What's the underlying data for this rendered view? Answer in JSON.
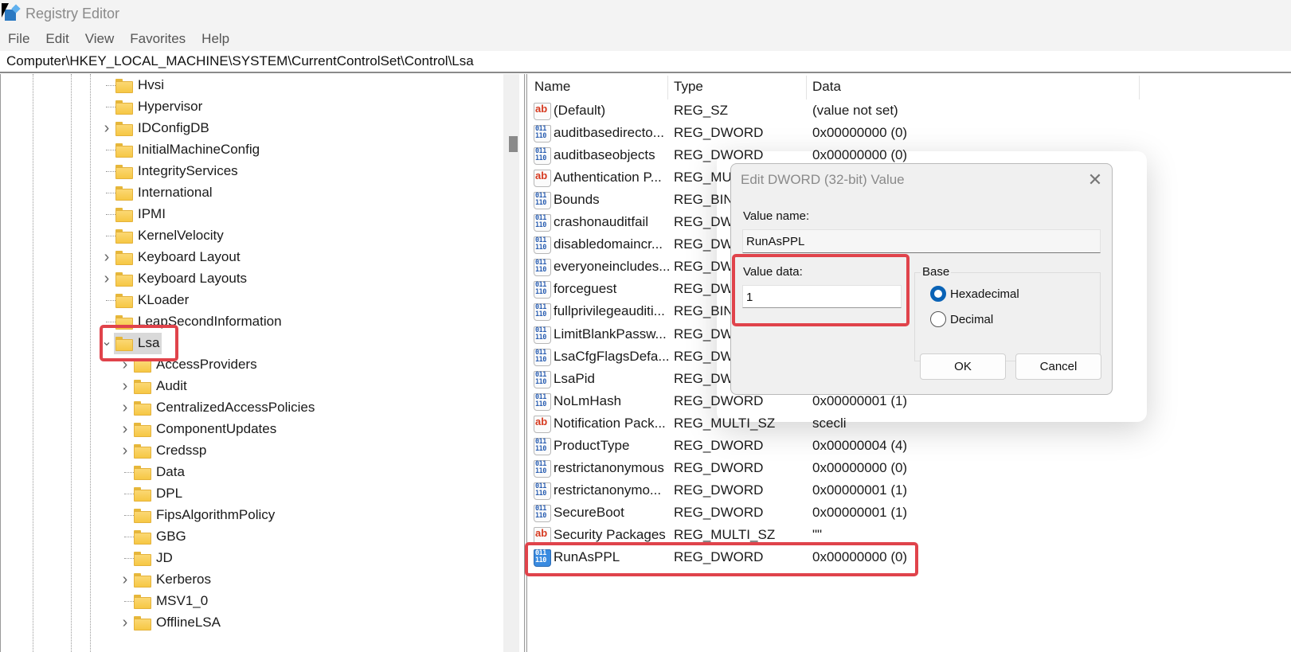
{
  "window": {
    "title": "Registry Editor",
    "app_icon": "registry-editor-icon"
  },
  "menu": [
    "File",
    "Edit",
    "View",
    "Favorites",
    "Help"
  ],
  "address": "Computer\\HKEY_LOCAL_MACHINE\\SYSTEM\\CurrentControlSet\\Control\\Lsa",
  "tree": {
    "items": [
      {
        "label": "Hvsi",
        "level": 0,
        "expander": "none"
      },
      {
        "label": "Hypervisor",
        "level": 0,
        "expander": "none"
      },
      {
        "label": "IDConfigDB",
        "level": 0,
        "expander": "collapsed"
      },
      {
        "label": "InitialMachineConfig",
        "level": 0,
        "expander": "none"
      },
      {
        "label": "IntegrityServices",
        "level": 0,
        "expander": "none"
      },
      {
        "label": "International",
        "level": 0,
        "expander": "none"
      },
      {
        "label": "IPMI",
        "level": 0,
        "expander": "none"
      },
      {
        "label": "KernelVelocity",
        "level": 0,
        "expander": "none"
      },
      {
        "label": "Keyboard Layout",
        "level": 0,
        "expander": "collapsed"
      },
      {
        "label": "Keyboard Layouts",
        "level": 0,
        "expander": "collapsed"
      },
      {
        "label": "KLoader",
        "level": 0,
        "expander": "none"
      },
      {
        "label": "LeapSecondInformation",
        "level": 0,
        "expander": "none"
      },
      {
        "label": "Lsa",
        "level": 0,
        "expander": "expanded",
        "selected": true
      },
      {
        "label": "AccessProviders",
        "level": 1,
        "expander": "collapsed"
      },
      {
        "label": "Audit",
        "level": 1,
        "expander": "collapsed"
      },
      {
        "label": "CentralizedAccessPolicies",
        "level": 1,
        "expander": "collapsed"
      },
      {
        "label": "ComponentUpdates",
        "level": 1,
        "expander": "collapsed"
      },
      {
        "label": "Credssp",
        "level": 1,
        "expander": "collapsed"
      },
      {
        "label": "Data",
        "level": 1,
        "expander": "none"
      },
      {
        "label": "DPL",
        "level": 1,
        "expander": "none"
      },
      {
        "label": "FipsAlgorithmPolicy",
        "level": 1,
        "expander": "none"
      },
      {
        "label": "GBG",
        "level": 1,
        "expander": "none"
      },
      {
        "label": "JD",
        "level": 1,
        "expander": "none"
      },
      {
        "label": "Kerberos",
        "level": 1,
        "expander": "collapsed"
      },
      {
        "label": "MSV1_0",
        "level": 1,
        "expander": "none"
      },
      {
        "label": "OfflineLSA",
        "level": 1,
        "expander": "collapsed"
      }
    ]
  },
  "list": {
    "columns": [
      "Name",
      "Type",
      "Data"
    ],
    "rows": [
      {
        "icon": "string",
        "name": "(Default)",
        "type": "REG_SZ",
        "data": "(value not set)"
      },
      {
        "icon": "binary",
        "name": "auditbasedirecto...",
        "type": "REG_DWORD",
        "data": "0x00000000 (0)"
      },
      {
        "icon": "binary",
        "name": "auditbaseobjects",
        "type": "REG_DWORD",
        "data": "0x00000000 (0)"
      },
      {
        "icon": "string",
        "name": "Authentication P...",
        "type": "REG_MULTI_SZ",
        "data": ""
      },
      {
        "icon": "binary",
        "name": "Bounds",
        "type": "REG_BINARY",
        "data": ""
      },
      {
        "icon": "binary",
        "name": "crashonauditfail",
        "type": "REG_DWORD",
        "data": ""
      },
      {
        "icon": "binary",
        "name": "disabledomaincr...",
        "type": "REG_DWORD",
        "data": ""
      },
      {
        "icon": "binary",
        "name": "everyoneincludes...",
        "type": "REG_DWORD",
        "data": ""
      },
      {
        "icon": "binary",
        "name": "forceguest",
        "type": "REG_DWORD",
        "data": ""
      },
      {
        "icon": "binary",
        "name": "fullprivilegeauditi...",
        "type": "REG_BINARY",
        "data": ""
      },
      {
        "icon": "binary",
        "name": "LimitBlankPassw...",
        "type": "REG_DWORD",
        "data": ""
      },
      {
        "icon": "binary",
        "name": "LsaCfgFlagsDefa...",
        "type": "REG_DWORD",
        "data": ""
      },
      {
        "icon": "binary",
        "name": "LsaPid",
        "type": "REG_DWORD",
        "data": ""
      },
      {
        "icon": "binary",
        "name": "NoLmHash",
        "type": "REG_DWORD",
        "data": "0x00000001 (1)"
      },
      {
        "icon": "string",
        "name": "Notification Pack...",
        "type": "REG_MULTI_SZ",
        "data": "scecli"
      },
      {
        "icon": "binary",
        "name": "ProductType",
        "type": "REG_DWORD",
        "data": "0x00000004 (4)"
      },
      {
        "icon": "binary",
        "name": "restrictanonymous",
        "type": "REG_DWORD",
        "data": "0x00000000 (0)"
      },
      {
        "icon": "binary",
        "name": "restrictanonymo...",
        "type": "REG_DWORD",
        "data": "0x00000001 (1)"
      },
      {
        "icon": "binary",
        "name": "SecureBoot",
        "type": "REG_DWORD",
        "data": "0x00000001 (1)"
      },
      {
        "icon": "string",
        "name": "Security Packages",
        "type": "REG_MULTI_SZ",
        "data": "\"\""
      },
      {
        "icon": "binary",
        "name": "RunAsPPL",
        "type": "REG_DWORD",
        "data": "0x00000000 (0)",
        "highlighted": true
      }
    ]
  },
  "dialog": {
    "title": "Edit DWORD (32-bit) Value",
    "value_name_label": "Value name:",
    "value_name": "RunAsPPL",
    "value_data_label": "Value data:",
    "value_data": "1",
    "base_label": "Base",
    "base_options": [
      {
        "label": "Hexadecimal",
        "checked": true
      },
      {
        "label": "Decimal",
        "checked": false
      }
    ],
    "ok_label": "OK",
    "cancel_label": "Cancel"
  },
  "annotation_color": "#e0434b",
  "accent_color": "#0a63b6"
}
